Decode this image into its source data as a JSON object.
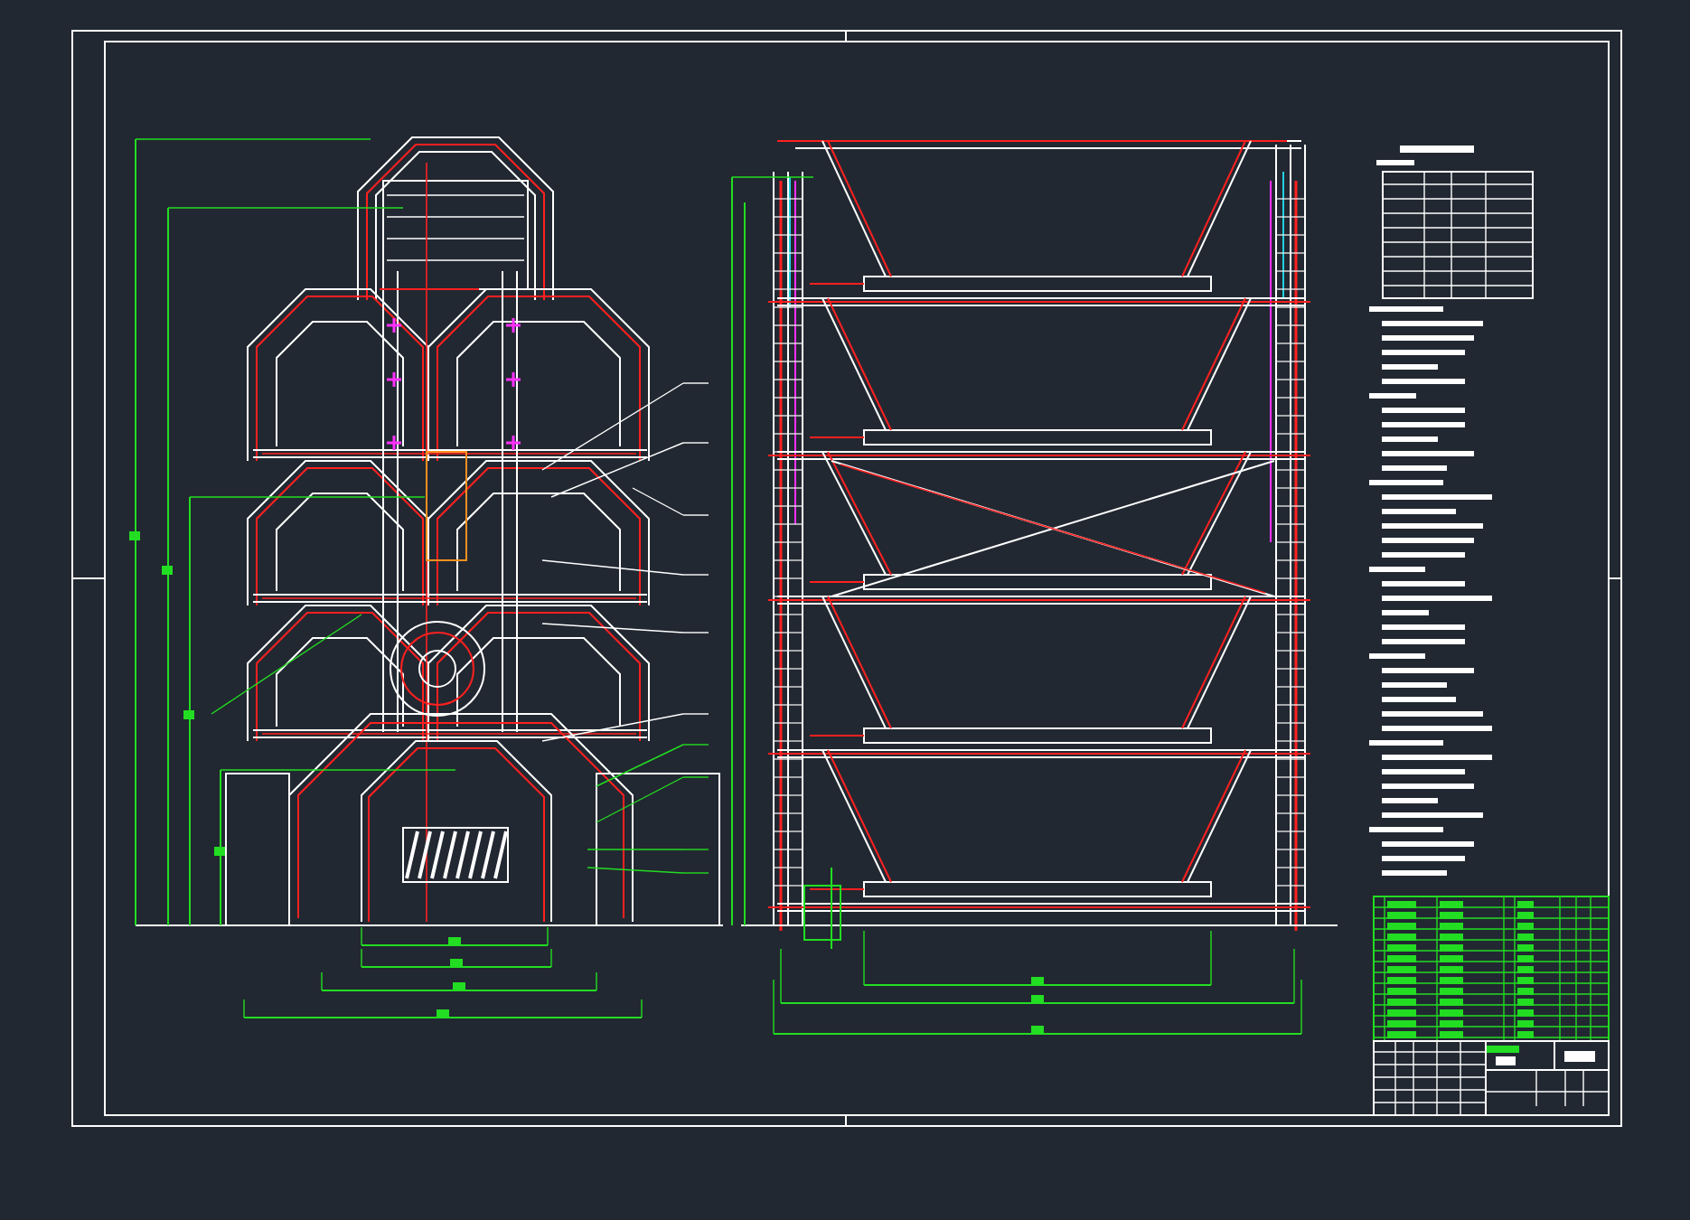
{
  "views": [
    {
      "kind": "side-elevation"
    },
    {
      "kind": "front-elevation"
    },
    {
      "kind": "notes"
    },
    {
      "kind": "parts-list"
    },
    {
      "kind": "title-block"
    }
  ]
}
